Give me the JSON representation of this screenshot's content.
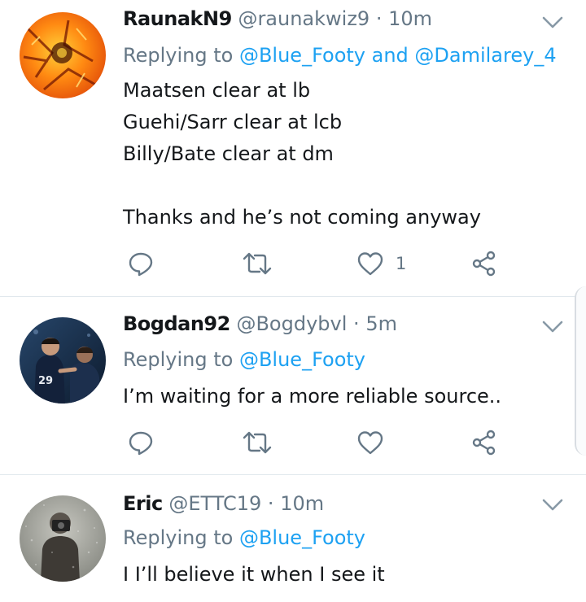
{
  "tweets": [
    {
      "name": "RaunakN9",
      "handle": "@raunakwiz9",
      "separator": "·",
      "time": "10m",
      "replying_prefix": "Replying to",
      "replying_to": "@Blue_Footy and @Damilarey_4",
      "lines": [
        "Maatsen clear at lb",
        "Guehi/Sarr clear at lcb",
        "Billy/Bate clear at dm",
        "",
        "Thanks and he’s not coming anyway"
      ],
      "like_count": "1",
      "avatar_icon": "fire-abstract-avatar"
    },
    {
      "name": "Bogdan92",
      "handle": "@Bogdybvl",
      "separator": "·",
      "time": "5m",
      "replying_prefix": "Replying to",
      "replying_to": "@Blue_Footy",
      "lines": [
        "I’m waiting for a more reliable source.."
      ],
      "like_count": "",
      "avatar_icon": "footballers-avatar"
    },
    {
      "name": "Eric",
      "handle": "@ETTC19",
      "separator": "·",
      "time": "10m",
      "replying_prefix": "Replying to",
      "replying_to": "@Blue_Footy",
      "lines": [
        "I I’ll believe it when I see it"
      ],
      "like_count": "",
      "avatar_icon": "photographer-avatar"
    }
  ],
  "icons": {
    "reply": "reply-icon",
    "retweet": "retweet-icon",
    "like": "like-icon",
    "share": "share-icon",
    "menu": "chevron-down-icon"
  },
  "colors": {
    "text": "#14171a",
    "secondary": "#657786",
    "mention": "#1da1f2",
    "divider": "#e1e8ed"
  }
}
